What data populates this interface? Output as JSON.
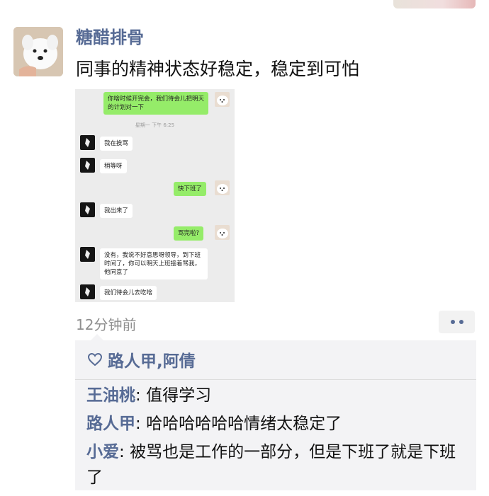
{
  "post": {
    "username": "糖醋排骨",
    "text": "同事的精神状态好稳定，稳定到可怕",
    "time_ago": "12分钟前"
  },
  "screenshot": {
    "messages": [
      {
        "side": "right",
        "text": "你啥时候开完会，我们待会儿把明天的计划对一下"
      },
      {
        "side": "right",
        "text": "快下班了"
      },
      {
        "side": "left",
        "text": "我在挨骂"
      },
      {
        "side": "left",
        "text": "稍等呀"
      },
      {
        "side": "left",
        "text": "我出来了"
      },
      {
        "side": "right",
        "text": "骂完啦?"
      },
      {
        "side": "left",
        "text": "没有，我说不好意思呀领导，到下班时间了，你可以明天上班接着骂我，他同意了"
      },
      {
        "side": "left",
        "text": "我们待会儿去吃啥"
      }
    ],
    "timestamp": "星期一 下午 6:25"
  },
  "likes": {
    "names": "路人甲,阿倩",
    "icon": "heart-outline-icon"
  },
  "comments": [
    {
      "author": "王油桃",
      "text": "值得学习"
    },
    {
      "author": "路人甲",
      "text": "哈哈哈哈哈哈情绪太稳定了"
    },
    {
      "author": "小爱",
      "text": "被骂也是工作的一部分，但是下班了就是下班了"
    }
  ],
  "colors": {
    "link": "#576b95",
    "bubble_green": "#95ec69",
    "panel_bg": "#f3f3f5",
    "chat_bg": "#ececec"
  }
}
